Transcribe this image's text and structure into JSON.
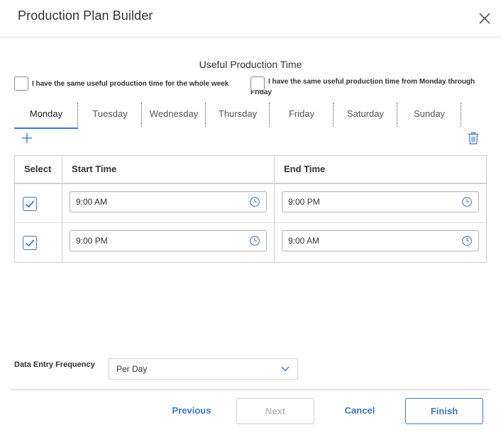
{
  "dialog": {
    "title": "Production Plan Builder",
    "close_icon": "close-icon"
  },
  "section": {
    "title": "Useful Production Time"
  },
  "options": {
    "same_whole_week": "I have the same useful production time for the whole week",
    "same_mon_fri": "I have the same useful production time from Monday through Friday"
  },
  "tabs": [
    {
      "label": "Monday",
      "active": true
    },
    {
      "label": "Tuesday",
      "active": false
    },
    {
      "label": "Wednesday",
      "active": false
    },
    {
      "label": "Thursday",
      "active": false
    },
    {
      "label": "Friday",
      "active": false
    },
    {
      "label": "Saturday",
      "active": false
    },
    {
      "label": "Sunday",
      "active": false
    }
  ],
  "toolbar": {
    "add_icon": "plus-icon",
    "delete_icon": "trash-icon"
  },
  "grid": {
    "headers": {
      "select": "Select",
      "start": "Start Time",
      "end": "End Time"
    },
    "rows": [
      {
        "selected": true,
        "start": "9:00 AM",
        "end": "9:00 PM"
      },
      {
        "selected": true,
        "start": "9:00 PM",
        "end": "9:00 AM"
      }
    ]
  },
  "frequency": {
    "label": "Data Entry Frequency",
    "value": "Per Day"
  },
  "footer": {
    "previous": "Previous",
    "next": "Next",
    "cancel": "Cancel",
    "finish": "Finish"
  },
  "colors": {
    "accent": "#3a79c4",
    "disabled_text": "#bdbdbd",
    "border": "#cfcfcf"
  }
}
